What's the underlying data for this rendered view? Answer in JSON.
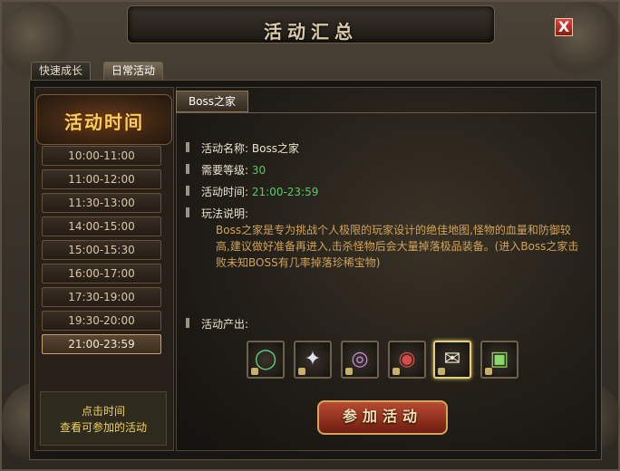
{
  "window": {
    "title": "活动汇总",
    "close_label": "X"
  },
  "tabs": [
    {
      "label": "快速成长"
    },
    {
      "label": "日常活动"
    }
  ],
  "left": {
    "heading": "活动时间",
    "slots": [
      "10:00-11:00",
      "11:00-12:00",
      "11:30-13:00",
      "14:00-15:00",
      "15:00-15:30",
      "16:00-17:00",
      "17:30-19:00",
      "19:30-20:00",
      "21:00-23:59"
    ],
    "hint_line1": "点击时间",
    "hint_line2": "查看可参加的活动"
  },
  "content": {
    "tab_label": "Boss之家",
    "name_label": "活动名称:",
    "name_value": "Boss之家",
    "level_label": "需要等级:",
    "level_value": "30",
    "time_label": "活动时间:",
    "time_value": "21:00-23:59",
    "rules_label": "玩法说明:",
    "description": "Boss之家是专为挑战个人极限的玩家设计的绝佳地图,怪物的血量和防御较高,建议做好准备再进入,击杀怪物后会大量掉落极品装备。(进入Boss之家击败未知BOSS有几率掉落珍稀宝物)",
    "rewards_label": "活动产出:",
    "rewards": [
      {
        "icon": "necklace-icon"
      },
      {
        "icon": "feather-icon"
      },
      {
        "icon": "ring-icon"
      },
      {
        "icon": "bracelet-icon"
      },
      {
        "icon": "scroll-icon"
      },
      {
        "icon": "box-icon"
      }
    ],
    "join_label": "参加活动"
  }
}
